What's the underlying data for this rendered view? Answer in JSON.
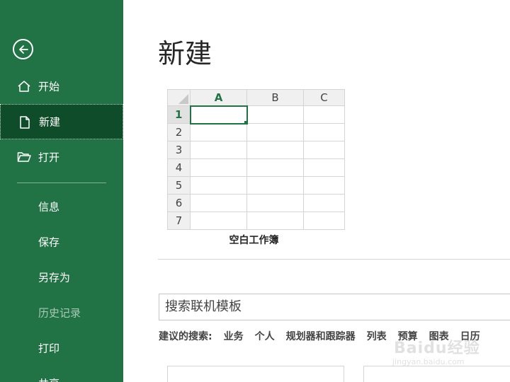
{
  "sidebar": {
    "items": [
      {
        "label": "开始",
        "icon": "home-icon"
      },
      {
        "label": "新建",
        "icon": "new-file-icon"
      },
      {
        "label": "打开",
        "icon": "open-folder-icon"
      },
      {
        "label": "信息"
      },
      {
        "label": "保存"
      },
      {
        "label": "另存为"
      },
      {
        "label": "历史记录"
      },
      {
        "label": "打印"
      },
      {
        "label": "共享"
      }
    ]
  },
  "main": {
    "title": "新建",
    "template": {
      "label": "空白工作簿",
      "columns": [
        "A",
        "B",
        "C"
      ],
      "rows": [
        "1",
        "2",
        "3",
        "4",
        "5",
        "6",
        "7"
      ]
    },
    "search": {
      "placeholder": "搜索联机模板"
    },
    "suggested": {
      "heading": "建议的搜索:",
      "links": [
        "业务",
        "个人",
        "规划器和跟踪器",
        "列表",
        "预算",
        "图表",
        "日历"
      ]
    }
  },
  "watermark": {
    "text": "Baidu经验",
    "sub": "jingyan.baidu.com"
  },
  "colors": {
    "sidebar": "#217346",
    "sidebar_active": "#0e4c2a",
    "accent": "#217346"
  }
}
